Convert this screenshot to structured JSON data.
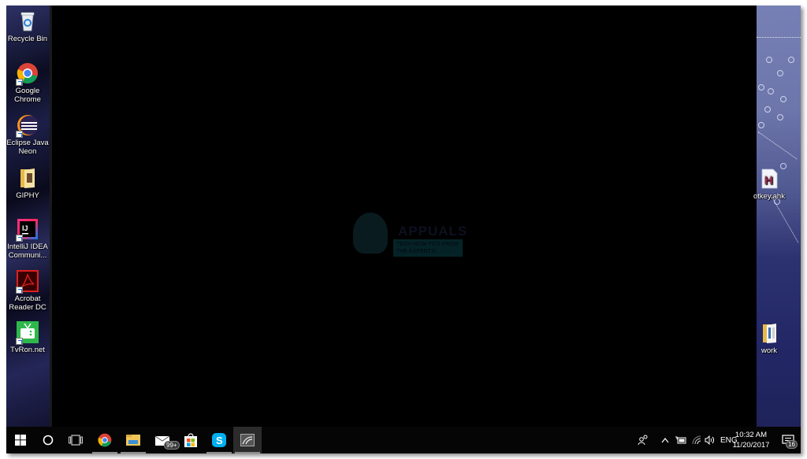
{
  "desktop": {
    "left_icons": [
      {
        "label": "Recycle Bin",
        "icon": "recycle-bin-icon",
        "shortcut": false
      },
      {
        "label": "Google Chrome",
        "icon": "chrome-icon",
        "shortcut": true
      },
      {
        "label": "Eclipse Java Neon",
        "icon": "eclipse-icon",
        "shortcut": true
      },
      {
        "label": "GIPHY",
        "icon": "folder-icon",
        "shortcut": false
      },
      {
        "label": "IntelliJ IDEA Communi...",
        "icon": "intellij-icon",
        "shortcut": true
      },
      {
        "label": "Acrobat Reader DC",
        "icon": "acrobat-icon",
        "shortcut": true
      },
      {
        "label": "TvRon.net",
        "icon": "tvron-icon",
        "shortcut": true
      }
    ],
    "right_icons": [
      {
        "label": "otkey.ahk",
        "icon": "ahk-script-icon",
        "glyph": "H"
      },
      {
        "label": "work",
        "icon": "folder-icon"
      }
    ],
    "watermark": {
      "title": "APPUALS",
      "tagline": "TECH HOW-TO'S FROM THE EXPERTS!"
    }
  },
  "taskbar": {
    "items": [
      {
        "name": "start-button",
        "icon": "windows-logo-icon"
      },
      {
        "name": "cortana-button",
        "icon": "search-circle-icon"
      },
      {
        "name": "task-view-button",
        "icon": "task-view-icon"
      },
      {
        "name": "chrome-taskbar",
        "icon": "chrome-icon",
        "active": true
      },
      {
        "name": "file-explorer-taskbar",
        "icon": "file-explorer-icon",
        "active": true
      },
      {
        "name": "mail-taskbar",
        "icon": "mail-icon",
        "badge": "99+"
      },
      {
        "name": "store-taskbar",
        "icon": "store-icon"
      },
      {
        "name": "skype-taskbar",
        "icon": "skype-icon",
        "active": true
      },
      {
        "name": "app-taskbar",
        "icon": "app-icon",
        "active": true,
        "selected": true
      }
    ],
    "tray": {
      "people_icon": "people-icon",
      "overflow_icon": "chevron-up-icon",
      "battery_icon": "battery-icon",
      "wifi_icon": "wifi-icon",
      "volume_icon": "volume-icon",
      "language": "ENG",
      "time": "10:32 AM",
      "date": "11/20/2017",
      "notifications_count": "16"
    }
  }
}
